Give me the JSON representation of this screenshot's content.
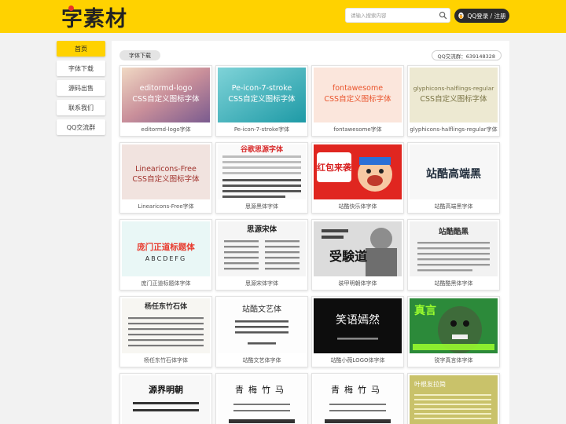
{
  "header": {
    "logo_text": "字素材",
    "search_placeholder": "请输入搜索内容",
    "login_label": "QQ登录 / 注册",
    "accent": "#ffd200"
  },
  "sidebar": {
    "items": [
      {
        "label": "首页",
        "active": true
      },
      {
        "label": "字体下载",
        "active": false
      },
      {
        "label": "源码出售",
        "active": false
      },
      {
        "label": "联系我们",
        "active": false
      },
      {
        "label": "QQ交流群",
        "active": false
      }
    ]
  },
  "main": {
    "section_title": "字体下载",
    "qq_group": "QQ交流群：639148328",
    "cards": [
      {
        "caption": "editormd-logo字体",
        "thumb": {
          "title": "editormd-logo",
          "sub": "CSS自定义图标字体"
        }
      },
      {
        "caption": "Pe-icon-7-stroke字体",
        "thumb": {
          "title": "Pe-icon-7-stroke",
          "sub": "CSS自定义图标字体"
        }
      },
      {
        "caption": "fontawesome字体",
        "thumb": {
          "title": "fontawesome",
          "sub": "CSS自定义图标字体"
        }
      },
      {
        "caption": "glyphicons-halflings-regular字体",
        "thumb": {
          "title": "glyphicons-halflings-regular",
          "sub": "CSS自定义图标字体"
        }
      },
      {
        "caption": "Linearicons-Free字体",
        "thumb": {
          "title": "Linearicons-Free",
          "sub": "CSS自定义图标字体"
        }
      },
      {
        "caption": "思源黑体字体",
        "thumb": {
          "title": "谷歌思源字体"
        }
      },
      {
        "caption": "站酷快乐体字体",
        "thumb": {
          "title": "红包来袭"
        }
      },
      {
        "caption": "站酷高端黑字体",
        "thumb": {
          "title": "站酷高端黑"
        }
      },
      {
        "caption": "庞门正道标题体字体",
        "thumb": {
          "title": "庞门正道标题体",
          "sub": "ABCDEFG"
        }
      },
      {
        "caption": "思源宋体字体",
        "thumb": {
          "title": "思源宋体"
        }
      },
      {
        "caption": "装甲明朝体字体",
        "thumb": {
          "title": "受験道"
        }
      },
      {
        "caption": "站酷酷黑体字体",
        "thumb": {
          "title": "站酷酷黑"
        }
      },
      {
        "caption": "杨任东竹石体字体",
        "thumb": {
          "title": "杨任东竹石体"
        }
      },
      {
        "caption": "站酷文艺体字体",
        "thumb": {
          "title": "站酷文艺体"
        }
      },
      {
        "caption": "站酷小薇LOGO体字体",
        "thumb": {
          "title": "笑语嫣然"
        }
      },
      {
        "caption": "锐字真言体字体",
        "thumb": {
          "title": "真言"
        }
      },
      {
        "caption": "",
        "thumb": {
          "title": "源界明朝"
        }
      },
      {
        "caption": "",
        "thumb": {
          "title": "青梅竹马"
        }
      },
      {
        "caption": "",
        "thumb": {
          "title": "青梅竹马"
        }
      },
      {
        "caption": "",
        "thumb": {
          "title": "叶根友拉简"
        }
      }
    ]
  }
}
